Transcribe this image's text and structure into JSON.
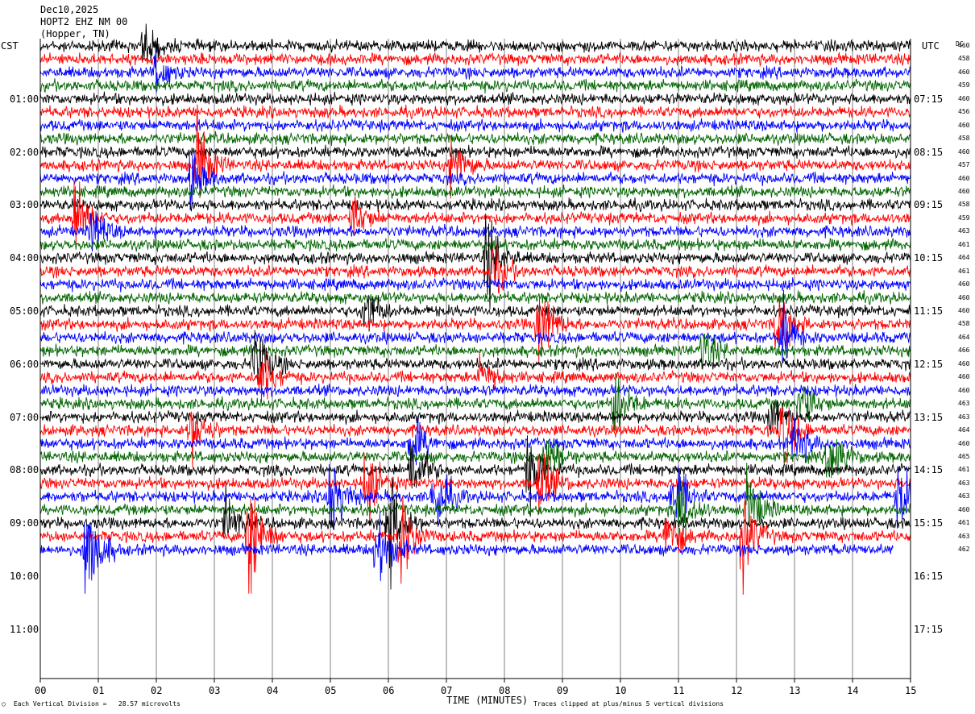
{
  "header": {
    "date": "Dec10,2025",
    "station": "HOPT2 EHZ NM 00",
    "location": "(Hopper, TN)"
  },
  "left_axis_label": "CST",
  "right_axis_label": "UTC",
  "dc_label": "DC",
  "chart_data": {
    "type": "helicorder",
    "xlabel": "TIME (MINUTES)",
    "x_ticks": [
      "00",
      "01",
      "02",
      "03",
      "04",
      "05",
      "06",
      "07",
      "08",
      "09",
      "10",
      "11",
      "12",
      "13",
      "14",
      "15"
    ],
    "xlim": [
      0,
      15
    ],
    "line_minutes": 15,
    "line_count": 39,
    "trace_colors": [
      "#000000",
      "#ff0000",
      "#0000ff",
      "#006400"
    ],
    "left_hour_labels": [
      "01:00",
      "02:00",
      "03:00",
      "04:00",
      "05:00",
      "06:00",
      "07:00",
      "08:00",
      "09:00",
      "10:00",
      "11:00"
    ],
    "right_hour_labels": [
      "07:15",
      "08:15",
      "09:15",
      "10:15",
      "11:15",
      "12:15",
      "13:15",
      "14:15",
      "15:15",
      "16:15",
      "17:15"
    ],
    "dc_offsets": [
      460,
      458,
      460,
      459,
      460,
      456,
      460,
      458,
      460,
      457,
      460,
      460,
      458,
      459,
      463,
      461,
      464,
      461,
      460,
      460,
      460,
      458,
      464,
      466,
      460,
      460,
      460,
      463,
      463,
      464,
      460,
      465,
      461,
      463,
      463,
      460,
      461,
      463,
      462
    ],
    "last_trace_end_minutes": 14.7,
    "events": [
      {
        "line": 0,
        "minute": 1.8,
        "amp": 1.5
      },
      {
        "line": 2,
        "minute": 2.0,
        "amp": 1.3
      },
      {
        "line": 9,
        "minute": 2.7,
        "amp": 3.0
      },
      {
        "line": 9,
        "minute": 7.1,
        "amp": 2.2
      },
      {
        "line": 10,
        "minute": 2.6,
        "amp": 1.8
      },
      {
        "line": 13,
        "minute": 0.6,
        "amp": 2.6
      },
      {
        "line": 13,
        "minute": 5.4,
        "amp": 1.6
      },
      {
        "line": 14,
        "minute": 0.9,
        "amp": 1.5
      },
      {
        "line": 16,
        "minute": 7.7,
        "amp": 3.0
      },
      {
        "line": 17,
        "minute": 7.8,
        "amp": 1.8
      },
      {
        "line": 20,
        "minute": 5.6,
        "amp": 1.8
      },
      {
        "line": 21,
        "minute": 8.6,
        "amp": 3.2
      },
      {
        "line": 21,
        "minute": 12.7,
        "amp": 2.4
      },
      {
        "line": 22,
        "minute": 12.8,
        "amp": 2.0
      },
      {
        "line": 23,
        "minute": 11.4,
        "amp": 1.6
      },
      {
        "line": 24,
        "minute": 3.7,
        "amp": 2.6
      },
      {
        "line": 25,
        "minute": 3.8,
        "amp": 2.0
      },
      {
        "line": 25,
        "minute": 7.6,
        "amp": 1.4
      },
      {
        "line": 27,
        "minute": 9.9,
        "amp": 2.4
      },
      {
        "line": 27,
        "minute": 13.1,
        "amp": 2.0
      },
      {
        "line": 28,
        "minute": 12.6,
        "amp": 1.6
      },
      {
        "line": 29,
        "minute": 2.6,
        "amp": 2.0
      },
      {
        "line": 29,
        "minute": 12.8,
        "amp": 2.4
      },
      {
        "line": 30,
        "minute": 13.0,
        "amp": 1.8
      },
      {
        "line": 30,
        "minute": 6.4,
        "amp": 2.0
      },
      {
        "line": 31,
        "minute": 13.6,
        "amp": 2.8
      },
      {
        "line": 31,
        "minute": 8.7,
        "amp": 2.0
      },
      {
        "line": 32,
        "minute": 6.4,
        "amp": 2.6
      },
      {
        "line": 32,
        "minute": 8.4,
        "amp": 2.2
      },
      {
        "line": 33,
        "minute": 5.6,
        "amp": 2.8
      },
      {
        "line": 33,
        "minute": 8.6,
        "amp": 2.4
      },
      {
        "line": 34,
        "minute": 5.0,
        "amp": 3.2
      },
      {
        "line": 34,
        "minute": 6.8,
        "amp": 2.8
      },
      {
        "line": 34,
        "minute": 10.9,
        "amp": 2.8
      },
      {
        "line": 34,
        "minute": 14.8,
        "amp": 2.6
      },
      {
        "line": 35,
        "minute": 11.0,
        "amp": 2.8
      },
      {
        "line": 35,
        "minute": 12.2,
        "amp": 2.6
      },
      {
        "line": 36,
        "minute": 6.0,
        "amp": 4.0
      },
      {
        "line": 36,
        "minute": 3.2,
        "amp": 1.8
      },
      {
        "line": 37,
        "minute": 3.6,
        "amp": 4.4
      },
      {
        "line": 37,
        "minute": 6.2,
        "amp": 3.6
      },
      {
        "line": 37,
        "minute": 12.1,
        "amp": 3.0
      },
      {
        "line": 37,
        "minute": 10.8,
        "amp": 2.2
      },
      {
        "line": 38,
        "minute": 0.8,
        "amp": 4.0
      },
      {
        "line": 38,
        "minute": 5.8,
        "amp": 3.0
      }
    ]
  },
  "footer": {
    "vertical_division": "Each Vertical Division =   28.57 microvolts",
    "clip_note": "Traces clipped at plus/minus 5 vertical divisions"
  }
}
